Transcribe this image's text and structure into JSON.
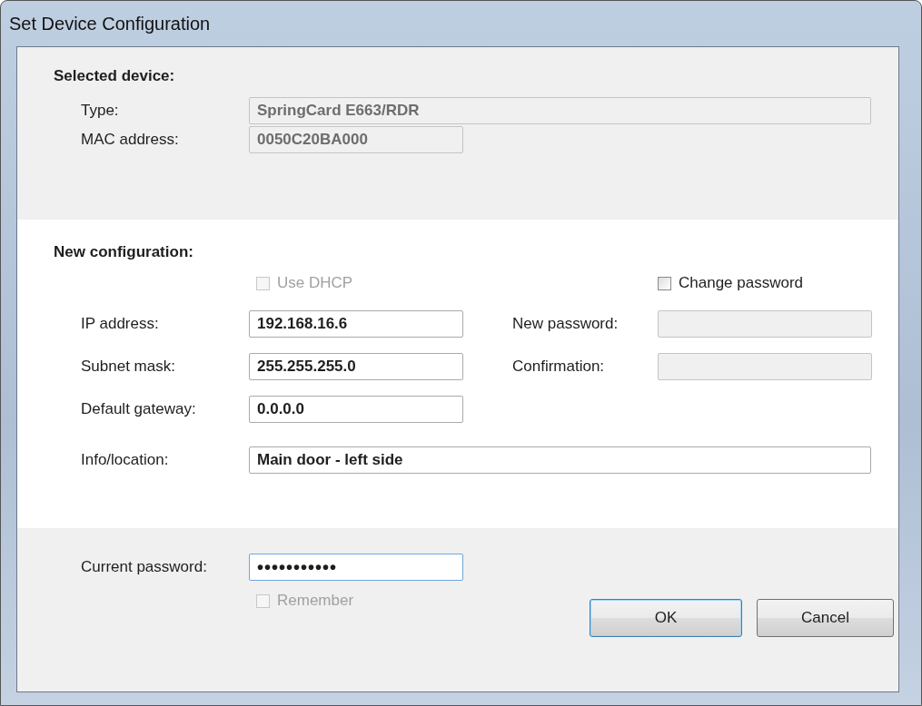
{
  "window": {
    "title": "Set Device Configuration"
  },
  "selected_device": {
    "heading": "Selected device:",
    "fields": [
      {
        "label": "Type:",
        "value": "SpringCard E663/RDR",
        "disabled": true,
        "wide": true
      },
      {
        "label": "MAC address:",
        "value": "0050C20BA000",
        "disabled": true,
        "wide": false
      }
    ]
  },
  "new_configuration": {
    "heading": "New configuration:",
    "use_dhcp": {
      "label": "Use DHCP",
      "checked": false,
      "disabled": true
    },
    "change_password": {
      "label": "Change password",
      "checked": false,
      "disabled": false
    },
    "network_fields": [
      {
        "label": "IP address:",
        "value": "192.168.16.6",
        "disabled": false
      },
      {
        "label": "Subnet mask:",
        "value": "255.255.255.0",
        "disabled": false
      },
      {
        "label": "Default gateway:",
        "value": "0.0.0.0",
        "disabled": false
      }
    ],
    "password_fields": [
      {
        "label": "New password:",
        "disabled": true
      },
      {
        "label": "Confirmation:",
        "disabled": true
      }
    ],
    "info": {
      "label": "Info/location:",
      "value": "Main door - left side",
      "disabled": false
    }
  },
  "footer": {
    "current_password": {
      "label": "Current password:",
      "value": "•••••••••••",
      "focused": true
    },
    "remember": {
      "label": "Remember",
      "checked": false,
      "disabled": true
    },
    "buttons": [
      {
        "label": "OK",
        "default": true
      },
      {
        "label": "Cancel",
        "default": false
      }
    ]
  }
}
